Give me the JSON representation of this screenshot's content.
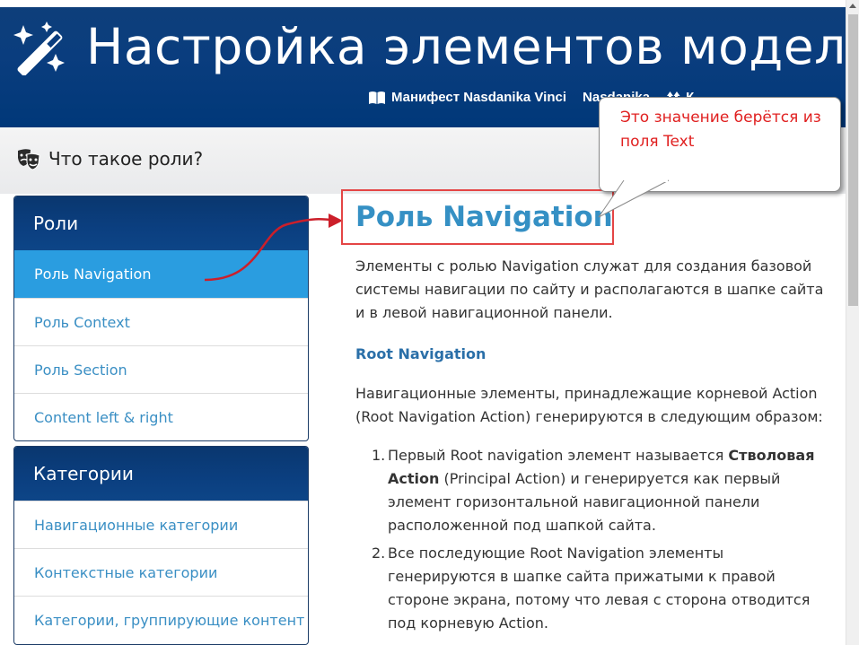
{
  "header": {
    "title": "Настройка элементов модели",
    "links": [
      {
        "icon": "book-icon",
        "label": "Манифест Nasdanika Vinci"
      },
      {
        "icon": "",
        "label": "Nasdanika"
      },
      {
        "icon": "arrows-icon",
        "label": "К..."
      }
    ]
  },
  "subbar": {
    "roles_link": "Что такое роли?"
  },
  "sidebar": {
    "roles": {
      "title": "Роли",
      "items": [
        "Роль Navigation",
        "Роль Context",
        "Роль Section",
        "Content left & right"
      ]
    },
    "categories": {
      "title": "Категории",
      "items": [
        "Навигационные категории",
        "Контекстные категории",
        "Категории, группирующие контент"
      ]
    }
  },
  "content": {
    "title": "Роль Navigation",
    "intro": "Элементы с ролью Navigation служат для создания базовой системы навигации по сайту и располагаются в шапке сайта и в левой навигационной панели.",
    "section_title": "Root Navigation",
    "section_intro": "Навигационные элементы, принадлежащие корневой Action (Root Navigation Action) генерируются в следующим образом:",
    "list": [
      {
        "num": "1.",
        "before": "Первый Root navigation элемент называется ",
        "bold": "Стволовая Action",
        "after": " (Principal Action) и генерируется как первый элемент горизонтальной навигационной панели расположенной под шапкой сайта."
      },
      {
        "num": "2.",
        "before": "Все последующие Root Navigation элементы генерируются в шапке сайта прижатыми к правой стороне экрана, потому что левая с сторона отводится под корневую Action.",
        "bold": "",
        "after": ""
      }
    ]
  },
  "callout": {
    "text": "Это значение берётся из поля Text"
  },
  "colors": {
    "header_bg": "#0a3d7e",
    "accent_active": "#2a9de0",
    "link": "#3a8fc4",
    "callout_text": "#e02020",
    "highlight_border": "#e44545"
  }
}
